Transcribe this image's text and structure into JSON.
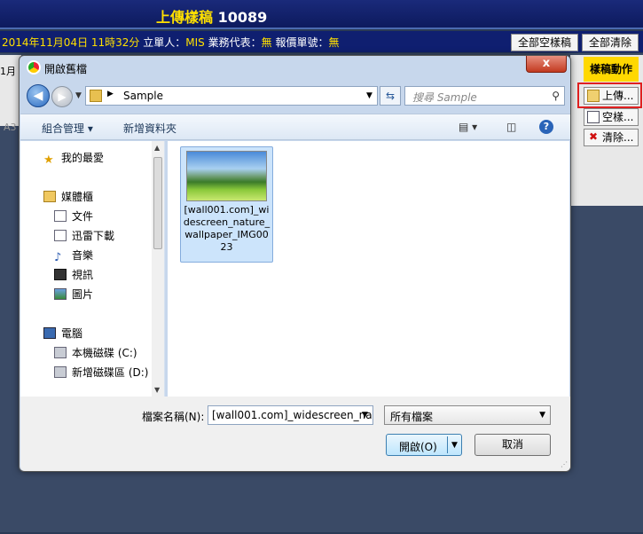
{
  "app": {
    "title_prefix": "上傳樣稿",
    "title_number": "10089",
    "date_text": "2014年11月04日 11時32分",
    "creator_label": "立單人：",
    "creator_value": "MIS",
    "rep_label": "業務代表：",
    "rep_value": "無",
    "quote_label": "報價單號：",
    "quote_value": "無",
    "btn_all_blank": "全部空樣稿",
    "btn_clear_all": "全部清除",
    "left_fragment": "1月",
    "left_fragment2": "A3",
    "action_header": "樣稿動作",
    "btn_upload": "上傳...",
    "btn_blank": "空樣...",
    "btn_clear": "清除..."
  },
  "dialog": {
    "title": "開啟舊檔",
    "close_glyph": "x",
    "address": {
      "breadcrumb": "Sample"
    },
    "search": {
      "placeholder": "搜尋 Sample"
    },
    "toolbar": {
      "organize": "組合管理 ▾",
      "new_folder": "新增資料夾"
    },
    "nav": {
      "favorites": "我的最愛",
      "libraries": "媒體櫃",
      "documents": "文件",
      "downloads": "迅雷下載",
      "music": "音樂",
      "videos": "視訊",
      "pictures": "圖片",
      "computer": "電腦",
      "local_disk": "本機磁碟 (C:)",
      "new_volume": "新增磁碟區 (D:)"
    },
    "files": [
      {
        "name": "[wall001.com]_widescreen_nature_wallpaper_IMG0023"
      }
    ],
    "filename_label": "檔案名稱(N):",
    "filename_value": "[wall001.com]_widescreen_na",
    "filetype_value": "所有檔案",
    "open_label": "開啟(O)",
    "cancel_label": "取消"
  },
  "colors": {
    "header_bg": "#0d1a5e",
    "title_yellow": "#ffe000",
    "highlight_red": "#e02020",
    "selection_blue": "#cce4fb"
  }
}
